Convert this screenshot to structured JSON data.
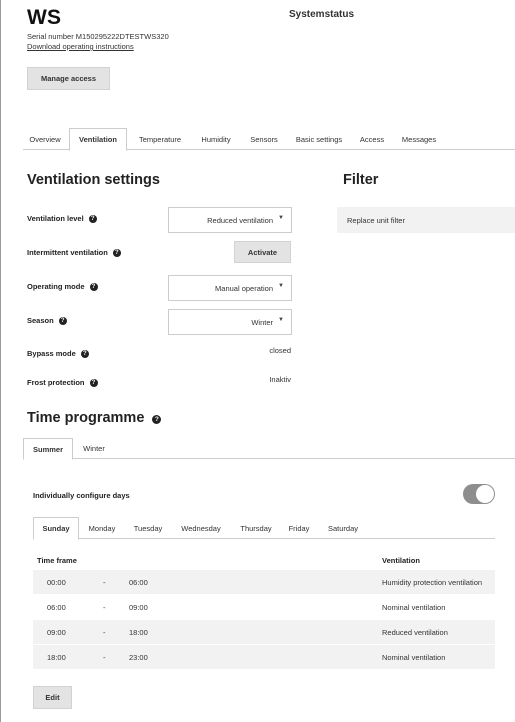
{
  "header": {
    "device_title": "WS",
    "serial": "Serial number M150295222DTESTWS320",
    "manual_link": "Download operating instructions",
    "status_title": "Systemstatus",
    "manage_access": "Manage access"
  },
  "main_tabs": [
    "Overview",
    "Ventilation",
    "Temperature",
    "Humidity",
    "Sensors",
    "Basic settings",
    "Access",
    "Messages"
  ],
  "active_tab": "Ventilation",
  "ventilation": {
    "heading": "Ventilation settings",
    "level_label": "Ventilation level",
    "level_value": "Reduced ventilation",
    "intermittent_label": "Intermittent ventilation",
    "activate_label": "Activate",
    "mode_label": "Operating mode",
    "mode_value": "Manual operation",
    "season_label": "Season",
    "season_value": "Winter",
    "bypass_label": "Bypass mode",
    "bypass_value": "closed",
    "frost_label": "Frost protection",
    "frost_value": "Inaktiv"
  },
  "filter": {
    "heading": "Filter",
    "message": "Replace unit filter"
  },
  "programme": {
    "heading": "Time programme",
    "season_tabs": [
      "Summer",
      "Winter"
    ],
    "active_season": "Summer",
    "individual_label": "Individually configure days",
    "individual_enabled": true,
    "day_tabs": [
      "Sunday",
      "Monday",
      "Tuesday",
      "Wednesday",
      "Thursday",
      "Friday",
      "Saturday"
    ],
    "active_day": "Sunday",
    "col_timeframe": "Time frame",
    "col_ventilation": "Ventilation",
    "rows": [
      {
        "start": "00:00",
        "sep": "-",
        "end": "06:00",
        "ventilation": "Humidity protection ventilation"
      },
      {
        "start": "06:00",
        "sep": "-",
        "end": "09:00",
        "ventilation": "Nominal ventilation"
      },
      {
        "start": "09:00",
        "sep": "-",
        "end": "18:00",
        "ventilation": "Reduced ventilation"
      },
      {
        "start": "18:00",
        "sep": "-",
        "end": "23:00",
        "ventilation": "Nominal ventilation"
      }
    ],
    "edit_label": "Edit"
  },
  "icons": {
    "help": "question-circle-icon",
    "dropdown": "caret-down-icon"
  }
}
